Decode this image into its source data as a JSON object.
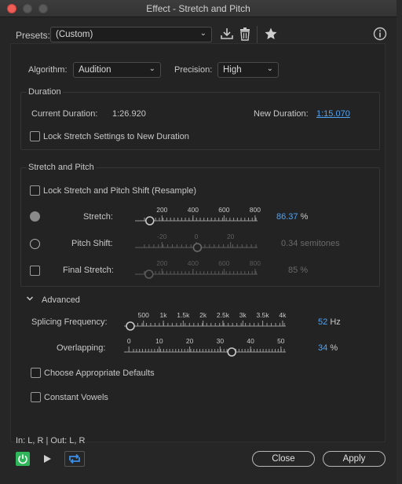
{
  "window": {
    "title": "Effect - Stretch and Pitch"
  },
  "presets": {
    "label": "Presets:",
    "value": "(Custom)"
  },
  "algorithm": {
    "label": "Algorithm:",
    "value": "Audition"
  },
  "precision": {
    "label": "Precision:",
    "value": "High"
  },
  "duration": {
    "group_title": "Duration",
    "current_label": "Current Duration:",
    "current_value": "1:26.920",
    "new_label": "New Duration:",
    "new_value": "1:15.070",
    "lock_label": "Lock Stretch Settings to New Duration"
  },
  "stretch_pitch": {
    "group_title": "Stretch and Pitch",
    "lock_label": "Lock Stretch and Pitch Shift (Resample)",
    "stretch": {
      "label": "Stretch:",
      "value": "86.37",
      "unit": "%",
      "ticks": [
        "200",
        "400",
        "600",
        "800"
      ],
      "level": 0.077
    },
    "pitch": {
      "label": "Pitch Shift:",
      "value": "0.34 semitones",
      "ticks": [
        "-20",
        "0",
        "20"
      ],
      "level": 0.51
    },
    "final": {
      "label": "Final Stretch:",
      "value": "85 %",
      "ticks": [
        "200",
        "400",
        "600",
        "800"
      ],
      "level": 0.07
    }
  },
  "advanced": {
    "label": "Advanced",
    "splicing": {
      "label": "Splicing Frequency:",
      "value": "52",
      "unit": "Hz",
      "ticks": [
        "500",
        "1k",
        "1.5k",
        "2k",
        "2.5k",
        "3k",
        "3.5k",
        "4k"
      ],
      "level": 0.0
    },
    "overlapping": {
      "label": "Overlapping:",
      "value": "34",
      "unit": "%",
      "ticks": [
        "0",
        "10",
        "20",
        "30",
        "40",
        "50"
      ],
      "level": 0.68
    },
    "defaults_label": "Choose Appropriate Defaults",
    "vowels_label": "Constant Vowels"
  },
  "footer": {
    "channels": "In: L, R | Out: L, R",
    "close_label": "Close",
    "apply_label": "Apply"
  },
  "colors": {
    "accent": "#4fa3f5",
    "power": "#2fb55a",
    "loop": "#3b8ee8"
  }
}
